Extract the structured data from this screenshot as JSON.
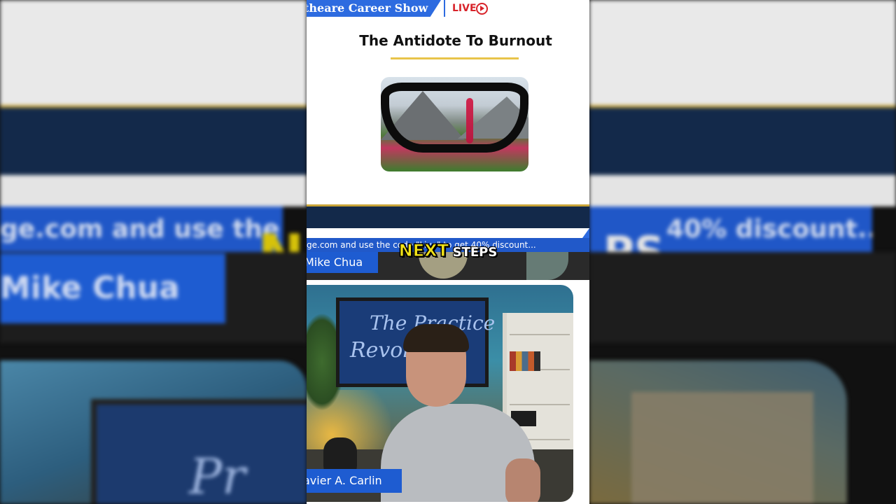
{
  "header": {
    "show_title": "theare Career Show",
    "live_label": "LIVE"
  },
  "slide": {
    "title": "The Antidote To Burnout"
  },
  "ticker": {
    "text": "ge.com and use the code \"Live\" to get 40% discount..."
  },
  "caption": {
    "word1": "NEXT",
    "word2": "STEPS"
  },
  "speakers": {
    "host_name": "Mike Chua",
    "guest_name": "avier A. Carlin"
  },
  "video": {
    "tv_line1": "The Practice",
    "tv_line2": "Revolution"
  },
  "background": {
    "ticker_left": "ge.com and use the",
    "ticker_right": "40% discount...",
    "host_name": "Mike Chua",
    "caption_left": "N",
    "caption_right": "PS",
    "tv_text": "Pr"
  },
  "colors": {
    "brand_blue": "#2d6be0",
    "navy": "#13294a",
    "gold": "#c8a437",
    "live_red": "#d8232a",
    "caption_yellow": "#f1e217"
  }
}
